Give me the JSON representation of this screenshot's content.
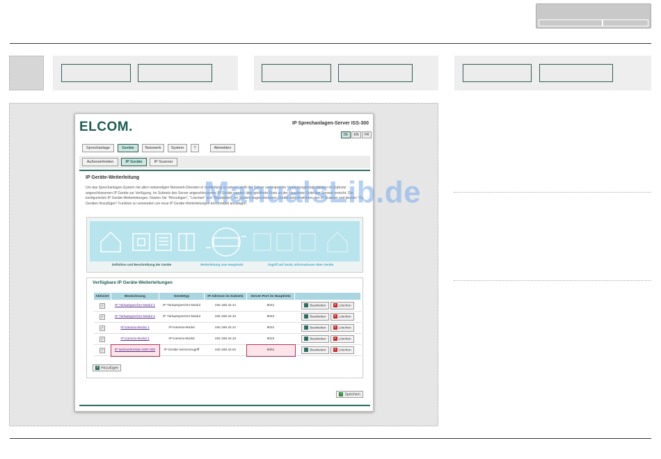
{
  "watermark": "ManualsLib.de",
  "shot": {
    "logo": "ELCOM.",
    "product": "IP Sprechanlagen-Server ISS-300",
    "languages": [
      "DE",
      "EN",
      "FR"
    ],
    "nav": [
      "Sprechanlage",
      "Geräte",
      "Netzwerk",
      "System",
      "?",
      "Abmelden"
    ],
    "subnav": [
      "Außeneinheiten",
      "IP Geräte",
      "IP Scanner"
    ],
    "title": "IP Geräte-Weiterleitung",
    "description": "Um das Sprechanlagen-System mit allen notwendigen Netzwerk-Diensten in Verbindung zu setzen, stellt der Server umfangreiche Verbindungsmöglichkeiten im Subnetz angeschlossenen IP Geräte zur Verfügung. Im Subnetz des Server angeschlossenen IP Geräte werden über geöffnete Ports an der Hauptnetz-Seite des Servers erreicht. Die konfigurierten IP Geräte-Weiterleitungen. Nutzen Sie \"Hinzufügen\", \"Löschen\" und \"Bearbeiten\". Im System angeschlossene Geräte wird empfohlen den IP Scanner und dessen \"Zu Geräten hinzufügen\" Funktion zu verwenden um neue IP Geräte-Weiterleitungen komfortabel anzulegen.",
    "diagram_labels": [
      "Definition und Beschreibung der Geräte",
      "Weiterleitung zum Hauptnetz",
      "Zugriff auf Gerät, Informationen über Geräte"
    ],
    "list_title": "Verfügbare IP Geräte-Weiterleitungen",
    "columns": [
      "Aktiviert",
      "Bezeichnung",
      "Gerätetyp",
      "IP Adresse im Subnetz",
      "Server-Port im Hauptnetz",
      ""
    ],
    "rows": [
      {
        "name": "IP Türlautsprecher-Modul 1",
        "type": "IP Türlautsprecher-Modul",
        "ip": "192.168.42.41",
        "port": "8041"
      },
      {
        "name": "IP Türlautsprecher-Modul 2",
        "type": "IP Türlautsprecher-Modul",
        "ip": "192.168.42.42",
        "port": "8042"
      },
      {
        "name": "IP Kamera-Modul 1",
        "type": "IP Kamera-Modul",
        "ip": "192.168.42.21",
        "port": "8021"
      },
      {
        "name": "IP Kamera-Modul 2",
        "type": "IP Kamera-Modul",
        "ip": "192.168.42.22",
        "port": "8022"
      },
      {
        "name": "IP Netzwerkrelais NSR-300",
        "type": "IP Geräte-Servicezugriff",
        "ip": "192.168.42.61",
        "port": "8061"
      }
    ],
    "edit_label": "Bearbeiten",
    "delete_label": "Löschen",
    "add_label": "Hinzufügen",
    "save_label": "Speichern"
  }
}
